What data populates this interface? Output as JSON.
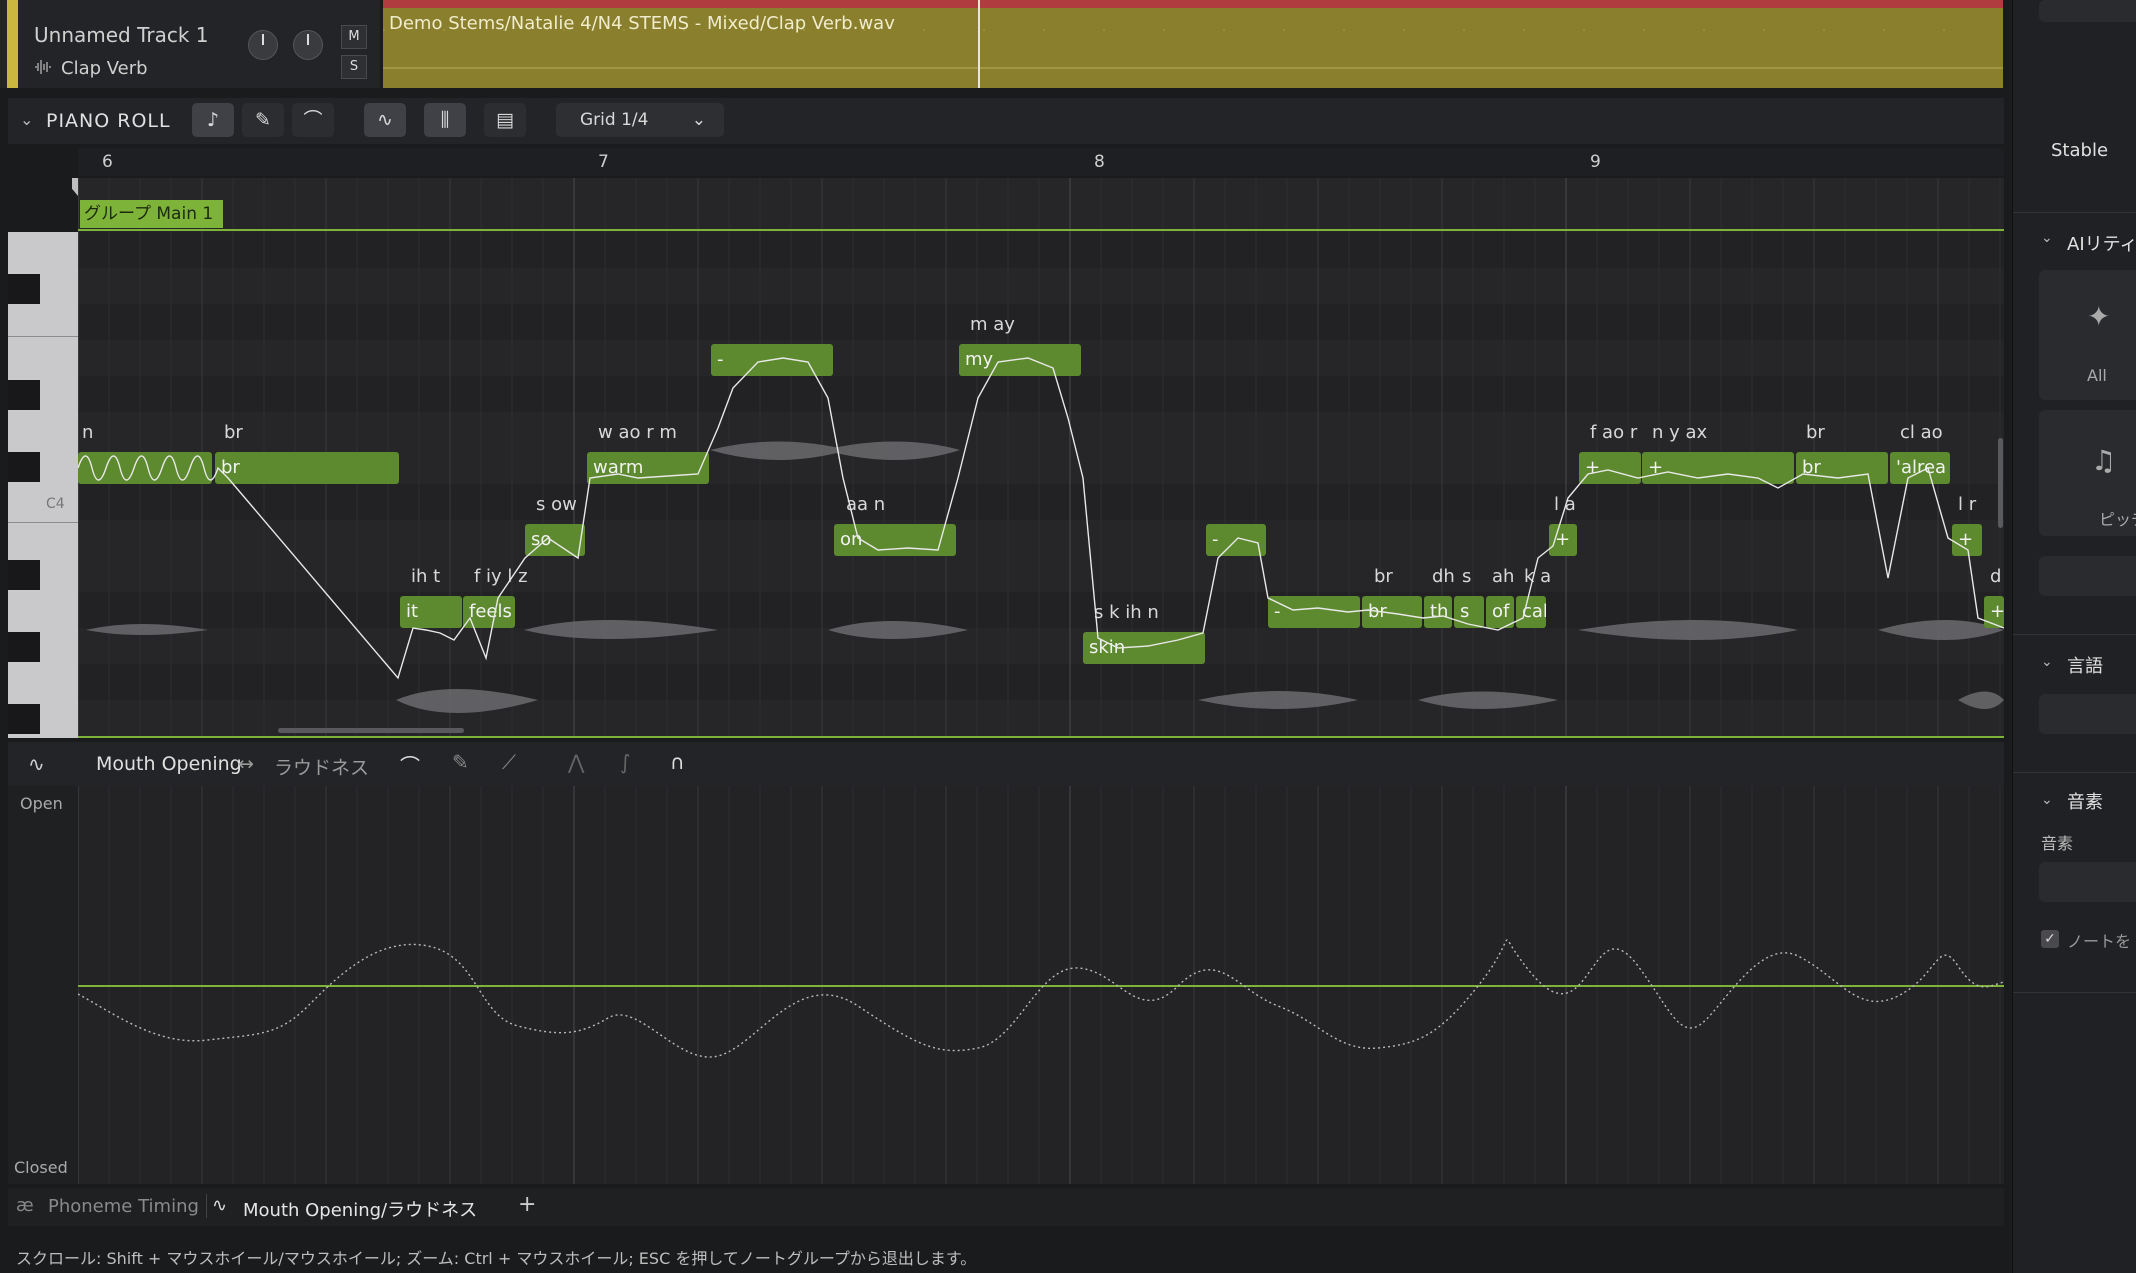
{
  "track": {
    "name": "Unnamed Track 1",
    "device": "Clap Verb",
    "mute_label": "M",
    "solo_label": "S",
    "clip_name": "Demo Stems/Natalie 4/N4 STEMS - Mixed/Clap Verb.wav"
  },
  "piano_roll": {
    "title": "PIANO ROLL",
    "grid_label": "Grid 1/4",
    "bars": [
      "6",
      "7",
      "8",
      "9"
    ],
    "c4_label": "C4",
    "group_label": "グループ Main 1"
  },
  "notes": [
    {
      "lyric": "br",
      "phoneme": "br"
    },
    {
      "lyric": "it",
      "phoneme": "ih t"
    },
    {
      "lyric": "feels",
      "phoneme": "f iy l z"
    },
    {
      "lyric": "so",
      "phoneme": "s ow"
    },
    {
      "lyric": "warm",
      "phoneme": "w ao r m"
    },
    {
      "lyric": "-",
      "phoneme": ""
    },
    {
      "lyric": "on",
      "phoneme": "aa n"
    },
    {
      "lyric": "my",
      "phoneme": "m ay"
    },
    {
      "lyric": "skin",
      "phoneme": "s k ih n"
    },
    {
      "lyric": "-",
      "phoneme": ""
    },
    {
      "lyric": "-",
      "phoneme": ""
    },
    {
      "lyric": "br",
      "phoneme": "br"
    },
    {
      "lyric": "th",
      "phoneme": "dh"
    },
    {
      "lyric": "s",
      "phoneme": "s"
    },
    {
      "lyric": "of",
      "phoneme": "ah"
    },
    {
      "lyric": "cal",
      "phoneme": "k a"
    },
    {
      "lyric": "+",
      "phoneme": "l a"
    },
    {
      "lyric": "+",
      "phoneme": "f ao r"
    },
    {
      "lyric": "+",
      "phoneme": "n y ax"
    },
    {
      "lyric": "br",
      "phoneme": "br"
    },
    {
      "lyric": "'alrea",
      "phoneme": "cl ao"
    },
    {
      "lyric": "+",
      "phoneme": "l r"
    },
    {
      "lyric": "+",
      "phoneme": "d"
    },
    {
      "lyric": "",
      "phoneme": "n"
    }
  ],
  "param_editor": {
    "param_name": "Mouth Opening",
    "swap_icon": "↔",
    "param_alt": "ラウドネス",
    "open_label": "Open",
    "closed_label": "Closed"
  },
  "tabs": {
    "phoneme_timing": "Phoneme Timing",
    "mouth_opening": "Mouth Opening/ラウドネス",
    "add": "+"
  },
  "status_text": "スクロール: Shift + マウスホイール/マウスホイール; ズーム: Ctrl + マウスホイール; ESC を押してノートグループから退出します。",
  "right_panel": {
    "stable_label": "Stable",
    "ai_section": "AIリティ",
    "all_label": "All",
    "pitch_label": "ピッチ",
    "language_section": "言語",
    "phoneme_section": "音素",
    "phoneme_field_label": "音素",
    "note_checkbox_label": "ノートを"
  },
  "colors": {
    "note_fill": "#5d8a2e",
    "group_tag": "#7eb33a",
    "track_accent": "#c9b740",
    "clip_fill": "#8a7f2c",
    "clip_top": "#b03c3f"
  }
}
